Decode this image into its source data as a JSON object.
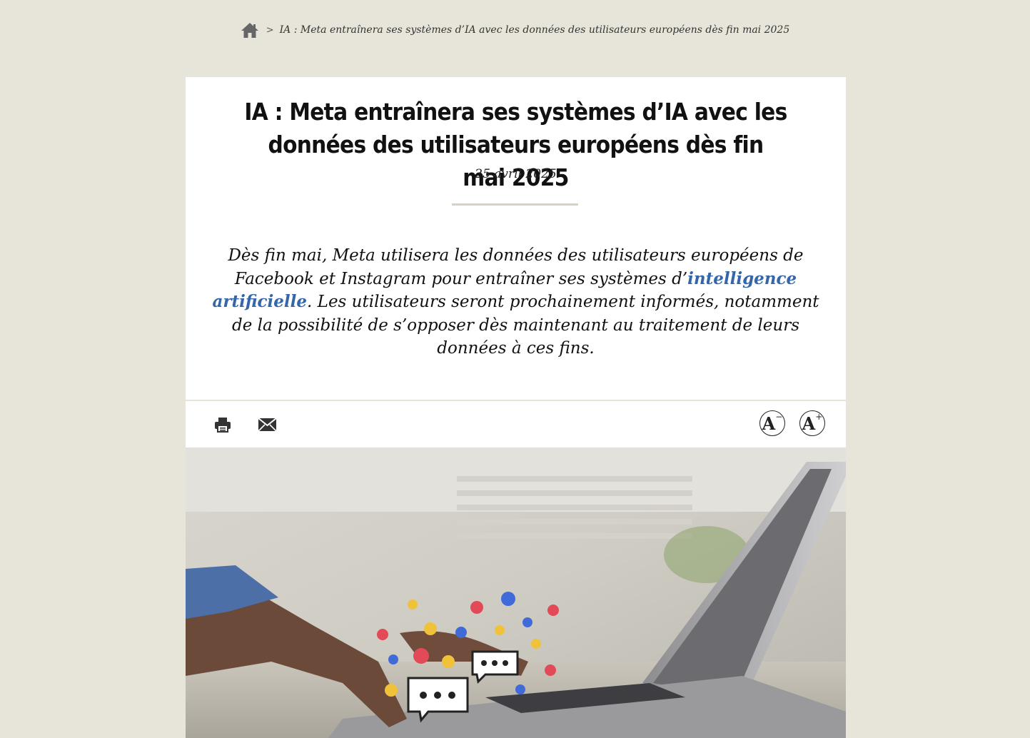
{
  "breadcrumb": {
    "home_icon": "home-icon",
    "separator": ">",
    "current": "IA : Meta entraînera ses systèmes d’IA avec les données des utilisateurs européens dès fin mai 2025"
  },
  "article": {
    "title": "IA : Meta entraînera ses systèmes d’IA avec les données des utilisateurs européens dès fin mai 2025",
    "date": "25 avril 2025",
    "lead_part1": "Dès fin mai, Meta utilisera les données des utilisateurs européens de Facebook et Instagram pour entraîner ses systèmes d’",
    "lead_link": "intelligence artificielle",
    "lead_part2": ". Les utilisateurs seront prochainement informés, notamment de la possibilité de s’opposer dès maintenant au traitement de leurs données à ces fins."
  },
  "toolbar": {
    "print_icon": "print-icon",
    "mail_icon": "mail-icon",
    "font_decrease": "A",
    "font_decrease_sign": "−",
    "font_increase": "A",
    "font_increase_sign": "+"
  },
  "colors": {
    "page_bg": "#e7e5da",
    "link": "#3366aa"
  }
}
